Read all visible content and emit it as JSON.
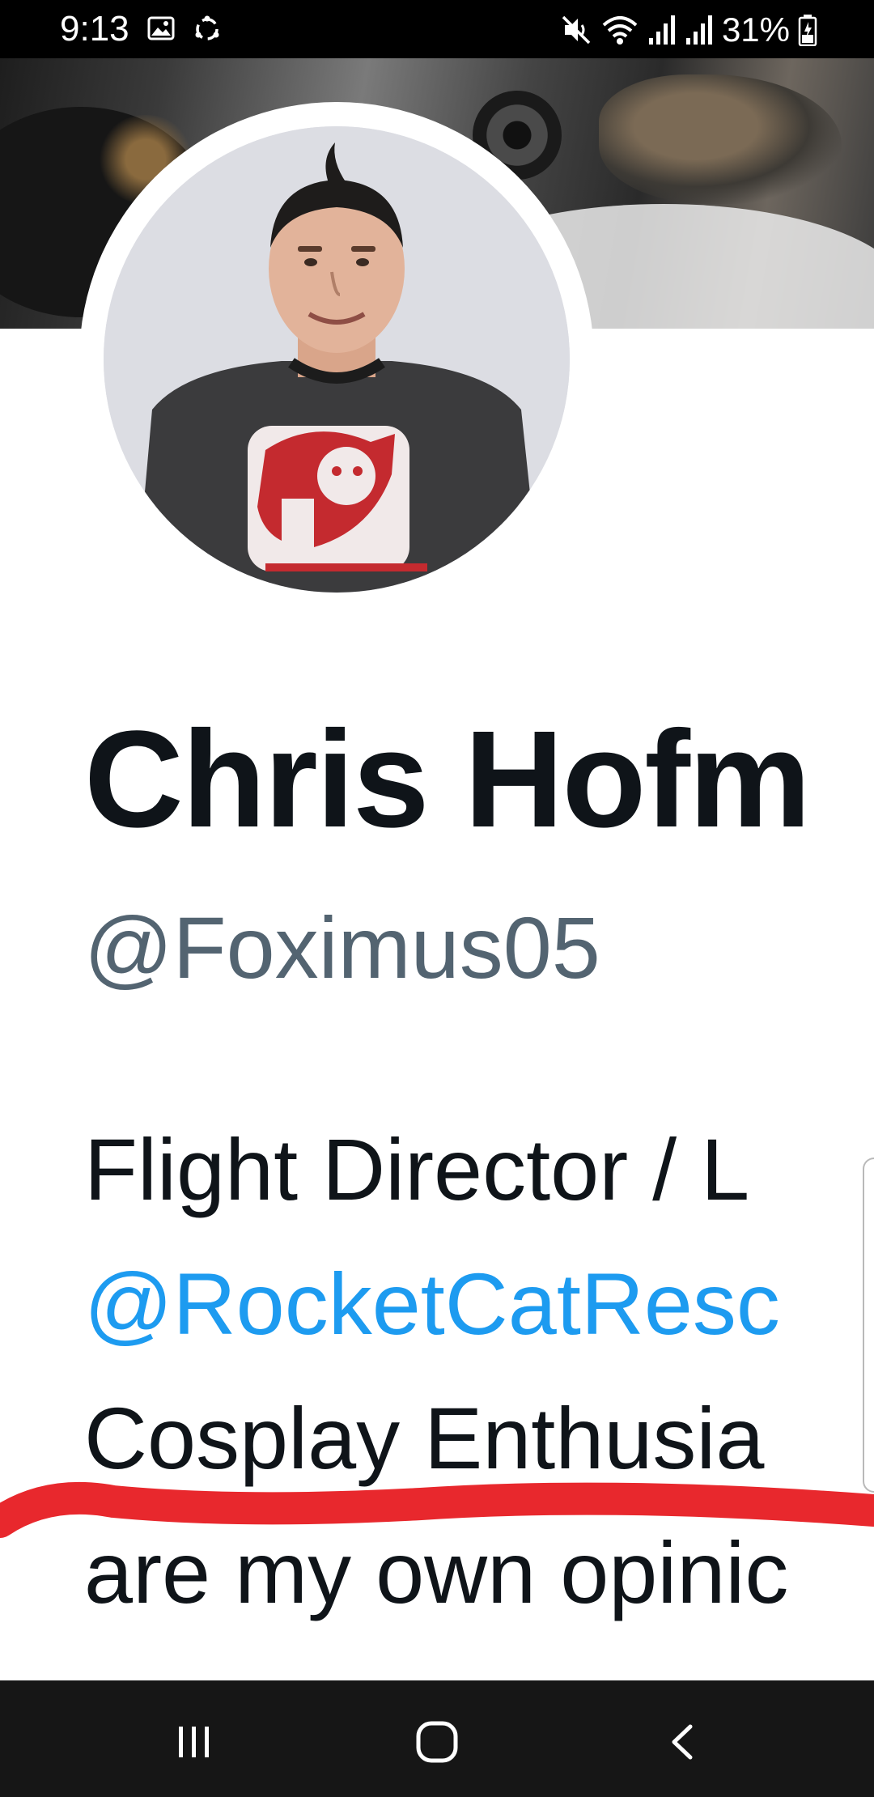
{
  "status_bar": {
    "time": "9:13",
    "battery_percent": "31%",
    "icons": [
      "gallery-icon",
      "sync-icon",
      "mute-icon",
      "wifi-icon",
      "signal-icon",
      "signal-icon-2",
      "battery-icon"
    ]
  },
  "profile": {
    "display_name": "Chris Hofm",
    "handle": "@Foximus05",
    "bio_lines": [
      {
        "text": "Flight Director / L",
        "type": "text"
      },
      {
        "text": "@RocketCatResc",
        "type": "link"
      },
      {
        "text": "Cosplay Enthusia",
        "type": "text"
      },
      {
        "text": "are my own opinic",
        "type": "text"
      }
    ]
  },
  "colors": {
    "name": "#0f1419",
    "handle": "#536471",
    "link": "#1d9bf0",
    "scribble": "#e8282d"
  },
  "nav_bar": {
    "buttons": [
      "recents-icon",
      "home-icon",
      "back-icon"
    ]
  }
}
